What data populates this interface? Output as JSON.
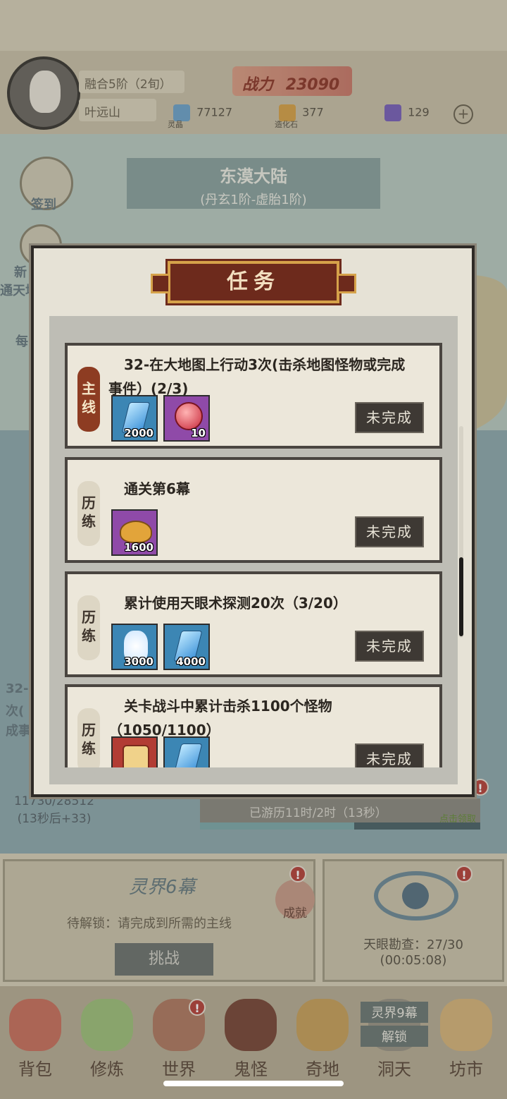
{
  "player": {
    "realm": "融合5阶（2旬）",
    "name": "叶远山",
    "power_label": "战力",
    "power_value": "23090"
  },
  "resources": [
    {
      "name": "灵晶",
      "value": "77127",
      "icon": "crystal-icon",
      "color": "#6fa3c8"
    },
    {
      "name": "造化石",
      "value": "377",
      "icon": "stone-icon",
      "color": "#d6a24a"
    },
    {
      "name": "",
      "value": "129",
      "icon": "spirit-flame-icon",
      "color": "#7b62b8"
    }
  ],
  "continent": {
    "name": "东漠大陆",
    "range": "(丹玄1阶-虚胎1阶)"
  },
  "side_buttons": [
    "签到",
    "新",
    "通天塔",
    "每"
  ],
  "background_texts": {
    "left_task_line1": "32-",
    "left_task_line2": "次(",
    "left_task_line3": "成事",
    "stat_line1": "11730/28512",
    "stat_line2": "(13秒后+33)"
  },
  "journey": {
    "text": "已游历11时/2时（13秒）",
    "claim": "点击领取"
  },
  "realm_panel": {
    "title": "灵界6幕",
    "subtitle": "待解锁：请完成到所需的主线",
    "button": "挑战",
    "achievement": "成就"
  },
  "sky_eye_panel": {
    "line1": "天眼勘查：27/30",
    "line2": "(00:05:08)"
  },
  "nav": [
    {
      "label": "背包",
      "icon": "backpack-icon",
      "badge": ""
    },
    {
      "label": "修炼",
      "icon": "cultivate-icon",
      "badge": ""
    },
    {
      "label": "世界",
      "icon": "world-icon",
      "badge": "!"
    },
    {
      "label": "鬼怪",
      "icon": "monster-icon",
      "badge": ""
    },
    {
      "label": "奇地",
      "icon": "wonderland-icon",
      "badge": ""
    },
    {
      "label": "洞天",
      "icon": "cave-icon",
      "badge": ""
    },
    {
      "label": "坊市",
      "icon": "market-icon",
      "badge": ""
    }
  ],
  "unlock_overlay": {
    "line1": "灵界9幕",
    "line2": "解锁"
  },
  "dialog": {
    "title": "任务",
    "tasks": [
      {
        "tag": "主线",
        "tag_style": "main",
        "text": "32-在大地图上行动3次(击杀地图怪物或完成事件）(2/3)",
        "rewards": [
          {
            "icon": "crystal-icon",
            "amount": "2000",
            "color": "blue"
          },
          {
            "icon": "red-orb-icon",
            "amount": "10",
            "color": "purple"
          }
        ],
        "status": "未完成"
      },
      {
        "tag": "历练",
        "tag_style": "normal",
        "text": "通关第6幕",
        "rewards": [
          {
            "icon": "pouch-icon",
            "amount": "1600",
            "color": "purple"
          }
        ],
        "status": "未完成"
      },
      {
        "tag": "历练",
        "tag_style": "normal",
        "text": "累计使用天眼术探测20次（3/20）",
        "rewards": [
          {
            "icon": "jar-icon",
            "amount": "3000",
            "color": "blue"
          },
          {
            "icon": "crystal-icon",
            "amount": "4000",
            "color": "blue"
          }
        ],
        "status": "未完成"
      },
      {
        "tag": "历练",
        "tag_style": "normal",
        "text": "关卡战斗中累计击杀1100个怪物（1050/1100）",
        "rewards": [
          {
            "icon": "scroll-icon",
            "amount": "",
            "color": "red"
          },
          {
            "icon": "crystal-icon",
            "amount": "",
            "color": "blue"
          }
        ],
        "status": "未完成"
      }
    ]
  }
}
